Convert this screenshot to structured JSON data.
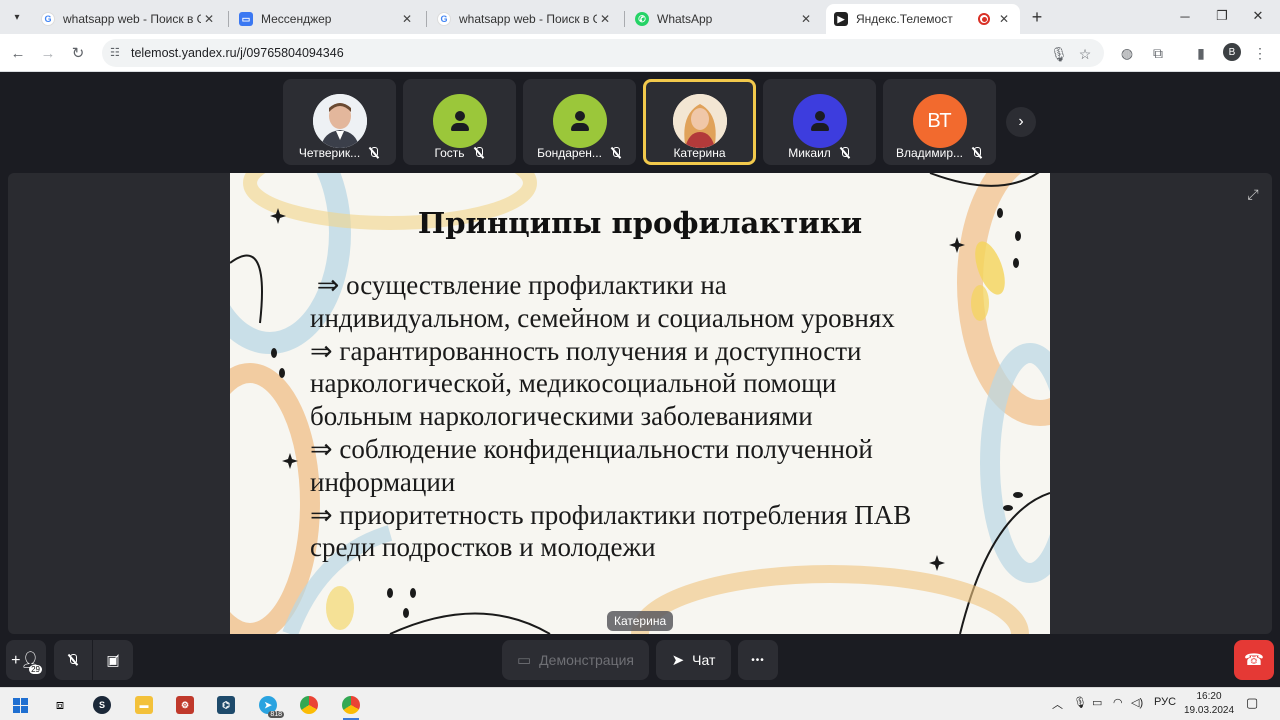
{
  "browser": {
    "tabs": [
      {
        "title": "whatsapp web - Поиск в Google",
        "icon": "google-icon",
        "active": false
      },
      {
        "title": "Мессенджер",
        "icon": "messenger-icon",
        "active": false
      },
      {
        "title": "whatsapp web - Поиск в Google",
        "icon": "google-icon",
        "active": false
      },
      {
        "title": "WhatsApp",
        "icon": "whatsapp-icon",
        "active": false
      },
      {
        "title": "Яндекс.Телемост",
        "icon": "telemost-icon",
        "active": true,
        "recording": true
      }
    ],
    "url": "telemost.yandex.ru/j/09765804094346",
    "profile_initial": "B"
  },
  "participants": [
    {
      "name": "Четверик...",
      "avatar_type": "photo",
      "avatar_color": "#c8d4e0",
      "mic_muted": true,
      "speaking": false
    },
    {
      "name": "Гость",
      "avatar_type": "person",
      "avatar_color": "#9bc73a",
      "mic_muted": true,
      "speaking": false
    },
    {
      "name": "Бондарен...",
      "avatar_type": "person",
      "avatar_color": "#9bc73a",
      "mic_muted": true,
      "speaking": false
    },
    {
      "name": "Катерина",
      "avatar_type": "photo",
      "avatar_color": "#d9a56a",
      "mic_muted": false,
      "speaking": true
    },
    {
      "name": "Микаил",
      "avatar_type": "person",
      "avatar_color": "#3d3dde",
      "mic_muted": true,
      "speaking": false
    },
    {
      "name": "Владимир...",
      "avatar_type": "initials",
      "initials": "ВТ",
      "avatar_color": "#f26a2e",
      "mic_muted": true,
      "speaking": false
    }
  ],
  "slide": {
    "title": "Принципы профилактики",
    "lines": [
      " ⇒ осуществление профилактики на",
      "индивидуальном, семейном и социальном уровнях",
      "⇒ гарантированность получения и доступности",
      "наркологической, медикосоциальной помощи",
      "больным наркологическими заболеваниями",
      "⇒ соблюдение конфиденциальности полученной",
      "информации",
      "⇒ приоритетность профилактики потребления ПАВ",
      "среди подростков и молодежи"
    ]
  },
  "speaker_label": "Катерина",
  "controls": {
    "invite_badge": "29",
    "demonstration_label": "Демонстрация",
    "chat_label": "Чат",
    "more_label": "•••"
  },
  "taskbar": {
    "language": "РУС",
    "time": "16:20",
    "date": "19.03.2024",
    "telegram_badge": "818"
  }
}
